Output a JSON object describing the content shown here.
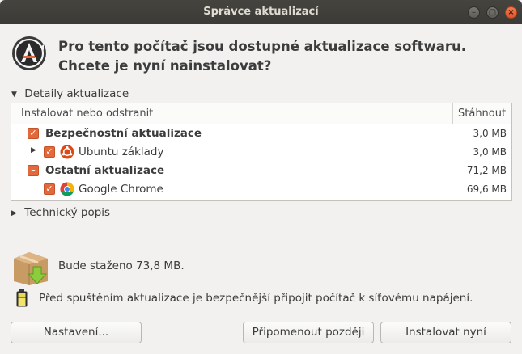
{
  "window": {
    "title": "Správce aktualizací",
    "controls": {
      "minimize": "–",
      "maximize": "▢",
      "close": "×"
    }
  },
  "header": {
    "icon": "software-updater-icon",
    "text": "Pro tento počítač jsou dostupné aktualizace softwaru. Chcete je nyní nainstalovat?"
  },
  "details_expander": {
    "label": "Detaily aktualizace",
    "expanded": true
  },
  "table": {
    "columns": [
      "Instalovat nebo odstranit",
      "Stáhnout"
    ],
    "rows": [
      {
        "label": "Bezpečnostní aktualizace",
        "size": "3,0 MB",
        "bold": true,
        "check": "checked"
      },
      {
        "label": "Ubuntu základy",
        "size": "3,0 MB",
        "bold": false,
        "check": "checked",
        "icon": "ubuntu-icon",
        "expandable": true
      },
      {
        "label": "Ostatní aktualizace",
        "size": "71,2 MB",
        "bold": true,
        "check": "indeterminate"
      },
      {
        "label": "Google Chrome",
        "size": "69,6 MB",
        "bold": false,
        "check": "checked",
        "icon": "chrome-icon"
      }
    ]
  },
  "tech_expander": {
    "label": "Technický popis",
    "expanded": false
  },
  "download_info": {
    "icon": "package-download-icon",
    "text": "Bude staženo 73,8 MB."
  },
  "power_info": {
    "icon": "battery-icon",
    "text": "Před spuštěním aktualizace je bezpečnější připojit počítač k síťovému napájení."
  },
  "buttons": {
    "settings": "Nastavení...",
    "remind_later": "Připomenout později",
    "install_now": "Instalovat nyní"
  },
  "colors": {
    "accent": "#e2693b",
    "titlebar": "#3f3e3a",
    "close": "#e9592f"
  }
}
